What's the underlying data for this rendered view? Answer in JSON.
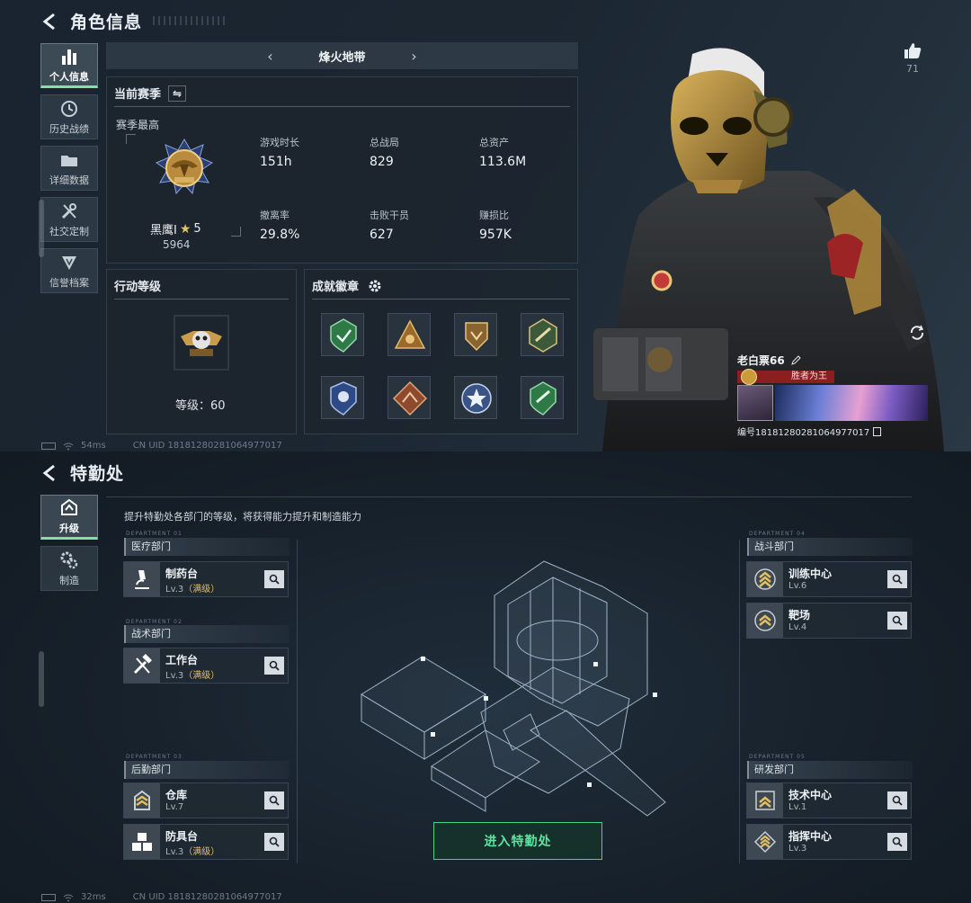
{
  "profile_screen": {
    "title": "角色信息",
    "nav": [
      {
        "label": "个人信息",
        "icon": "bar-chart-icon",
        "active": true
      },
      {
        "label": "历史战绩",
        "icon": "clock-icon",
        "active": false
      },
      {
        "label": "详细数据",
        "icon": "folder-icon",
        "active": false
      },
      {
        "label": "社交定制",
        "icon": "tools-icon",
        "active": false
      },
      {
        "label": "信誉档案",
        "icon": "shield-icon",
        "active": false
      }
    ],
    "map_selector": {
      "prev": "‹",
      "name": "烽火地带",
      "next": "›"
    },
    "season": {
      "header": "当前赛季",
      "best_label": "赛季最高",
      "rank_name": "黑鹰Ⅰ",
      "rank_star": "★",
      "rank_stars": "5",
      "rank_score": "5964",
      "stats": [
        {
          "label": "游戏时长",
          "value": "151h"
        },
        {
          "label": "总战局",
          "value": "829"
        },
        {
          "label": "总资产",
          "value": "113.6M"
        },
        {
          "label": "撤离率",
          "value": "29.8%"
        },
        {
          "label": "击败干员",
          "value": "627"
        },
        {
          "label": "赚损比",
          "value": "957K"
        }
      ]
    },
    "action_level": {
      "header": "行动等级",
      "level_text": "等级：60"
    },
    "achievements": {
      "header": "成就徽章",
      "badge_count": 8
    },
    "likes": {
      "count": "71"
    },
    "player": {
      "name": "老白票66",
      "tag": "胜者为王",
      "uid": "编号18181280281064977017"
    },
    "status": {
      "ping": "54ms",
      "uid": "CN UID 18181280281064977017"
    }
  },
  "special_ops_screen": {
    "title": "特勤处",
    "nav": [
      {
        "label": "升级",
        "icon": "upgrade-icon",
        "active": true
      },
      {
        "label": "制造",
        "icon": "gears-icon",
        "active": false
      }
    ],
    "description": "提升特勤处各部门的等级，将获得能力提升和制造能力",
    "departments": {
      "medical": {
        "name": "医疗部门",
        "facilities": [
          {
            "name": "制药台",
            "level": "Lv.3",
            "max": "（满级）"
          }
        ]
      },
      "tactical": {
        "name": "战术部门",
        "facilities": [
          {
            "name": "工作台",
            "level": "Lv.3",
            "max": "（满级）"
          }
        ]
      },
      "logistics": {
        "name": "后勤部门",
        "facilities": [
          {
            "name": "仓库",
            "level": "Lv.7",
            "max": ""
          },
          {
            "name": "防具台",
            "level": "Lv.3",
            "max": "（满级）"
          }
        ]
      },
      "combat": {
        "name": "战斗部门",
        "facilities": [
          {
            "name": "训练中心",
            "level": "Lv.6",
            "max": ""
          },
          {
            "name": "靶场",
            "level": "Lv.4",
            "max": ""
          }
        ]
      },
      "rnd": {
        "name": "研发部门",
        "facilities": [
          {
            "name": "技术中心",
            "level": "Lv.1",
            "max": ""
          },
          {
            "name": "指挥中心",
            "level": "Lv.3",
            "max": ""
          }
        ]
      }
    },
    "enter_button": "进入特勤处",
    "status": {
      "ping": "32ms",
      "uid": "CN UID 18181280281064977017"
    }
  },
  "colors": {
    "accent_green": "#5fe3a1",
    "maxed_gold": "#e2c060",
    "tag_red": "#8b1e1e"
  }
}
